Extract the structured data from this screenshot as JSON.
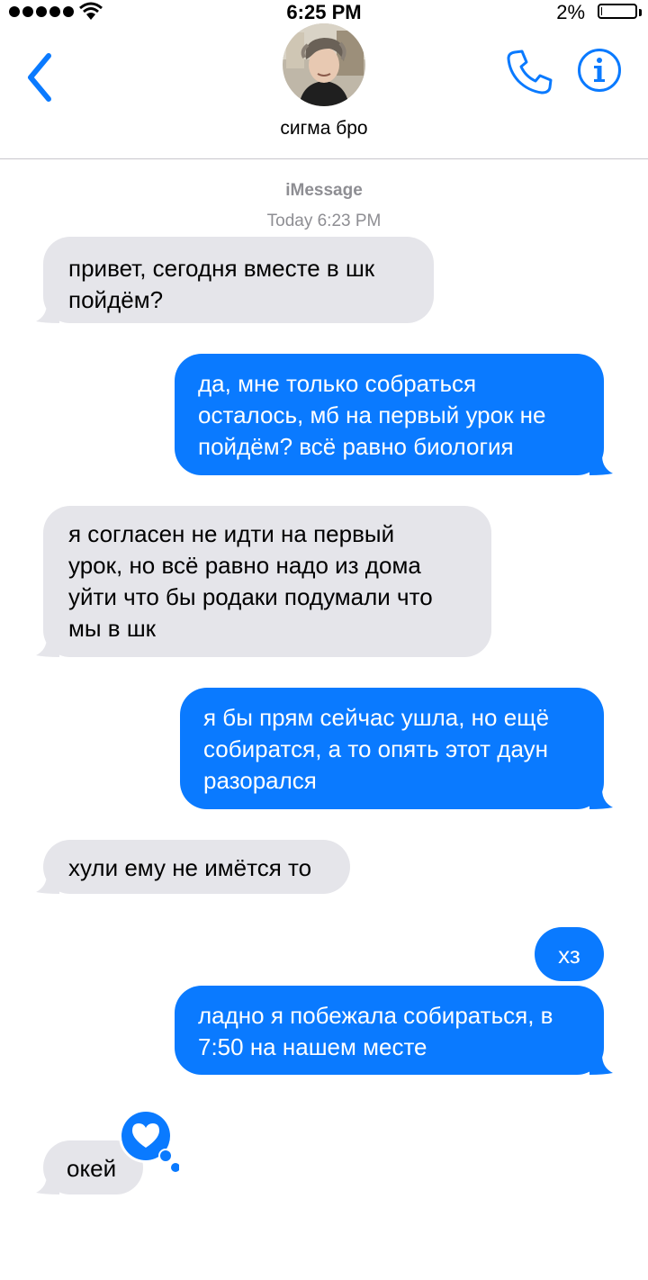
{
  "status_bar": {
    "time": "6:25 PM",
    "battery_percent": "2%",
    "battery_level": 0.02,
    "signal_bars": 5
  },
  "header": {
    "contact_name": "сигма бро",
    "icons": [
      "back-chevron-icon",
      "phone-icon",
      "info-icon"
    ],
    "accent_color": "#0a7aff"
  },
  "thread": {
    "service": "iMessage",
    "timestamp": "Today 6:23 PM",
    "messages": [
      {
        "direction": "incoming",
        "lines": [
          "привет, сегодня вместе в шк",
          "пойдём?"
        ]
      },
      {
        "direction": "outgoing",
        "lines": [
          "да, мне только собраться",
          "осталось, мб на первый урок не",
          "пойдём? всё равно биология"
        ]
      },
      {
        "direction": "incoming",
        "lines": [
          "я согласен не идти на первый",
          "урок, но всё равно надо из дома",
          "уйти что бы родаки подумали что",
          "мы в шк"
        ]
      },
      {
        "direction": "outgoing",
        "lines": [
          "я бы прям сейчас ушла, но ещё",
          "собиратся, а то опять этот даун",
          "разорался"
        ]
      },
      {
        "direction": "incoming",
        "lines": [
          "хули ему не имётся то"
        ]
      },
      {
        "direction": "outgoing",
        "lines": [
          "хз"
        ]
      },
      {
        "direction": "outgoing",
        "lines": [
          "ладно я побежала собираться, в",
          "7:50 на нашем месте"
        ]
      },
      {
        "direction": "incoming",
        "lines": [
          "окей"
        ],
        "tapback": "heart-icon"
      }
    ]
  }
}
